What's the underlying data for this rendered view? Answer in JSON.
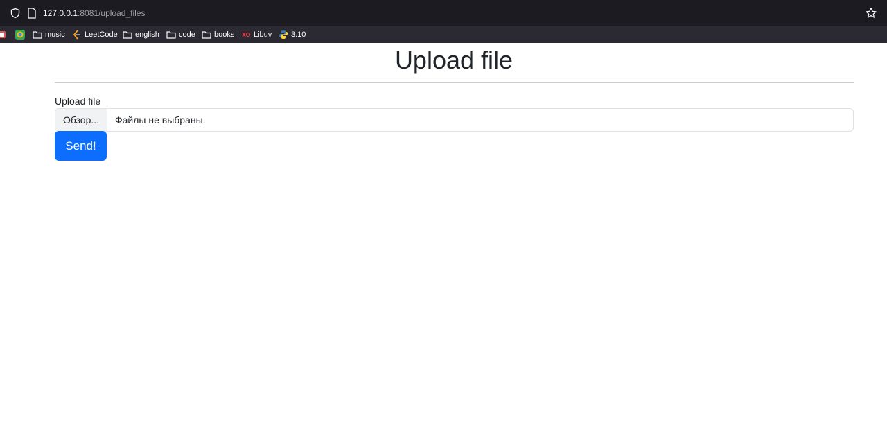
{
  "browser": {
    "url_host": "127.0.0.1",
    "url_rest": ":8081/upload_files",
    "bookmarks": [
      {
        "label": "",
        "icon": "app-icon"
      },
      {
        "label": "",
        "icon": "chrome-icon"
      },
      {
        "label": "music",
        "icon": "folder-icon"
      },
      {
        "label": "LeetCode",
        "icon": "leetcode-icon"
      },
      {
        "label": "english",
        "icon": "folder-icon"
      },
      {
        "label": "code",
        "icon": "folder-icon"
      },
      {
        "label": "books",
        "icon": "folder-icon"
      },
      {
        "label": "Libuv",
        "icon": "libuv-icon"
      },
      {
        "label": "3.10",
        "icon": "python-icon"
      }
    ]
  },
  "page": {
    "title": "Upload file",
    "field_label": "Upload file",
    "browse_label": "Обзор...",
    "file_status": "Файлы не выбраны.",
    "submit_label": "Send!"
  },
  "colors": {
    "primary": "#0d6efd",
    "chrome_bg": "#1c1b22",
    "bookmarks_bg": "#2b2a33"
  }
}
